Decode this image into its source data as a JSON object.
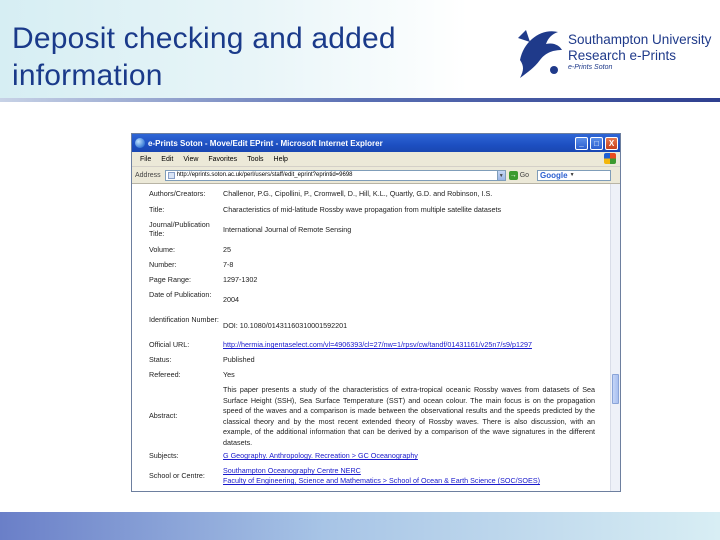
{
  "slide": {
    "title_line1": "Deposit checking and added",
    "title_line2": "information",
    "logo": {
      "line1": "Southampton University",
      "line2": "Research e-Prints",
      "line3": "e-Prints Soton"
    }
  },
  "browser": {
    "window_title": "e-Prints Soton - Move/Edit EPrint - Microsoft Internet Explorer",
    "buttons": {
      "minimize": "_",
      "maximize": "□",
      "close": "X"
    },
    "menu": [
      "File",
      "Edit",
      "View",
      "Favorites",
      "Tools",
      "Help"
    ],
    "address_label": "Address",
    "address_url": "http://eprints.soton.ac.uk/perl/users/staff/edit_eprint?eprintid=9698",
    "go_label": "Go",
    "search_engine": "Google"
  },
  "record": [
    {
      "label": "Authors/Creators:",
      "value": "Challenor, P.G., Cipollini, P., Cromwell, D., Hill, K.L., Quartly, G.D. and Robinson, I.S."
    },
    {
      "label": "Title:",
      "value": "Characteristics of mid-latitude Rossby wave propagation from multiple satellite datasets"
    },
    {
      "label": "Journal/Publication Title:",
      "value": "International Journal of Remote Sensing"
    },
    {
      "label": "Volume:",
      "value": "25"
    },
    {
      "label": "Number:",
      "value": "7-8"
    },
    {
      "label": "Page Range:",
      "value": "1297-1302"
    },
    {
      "label": "Date of Publication:",
      "value": "2004"
    },
    {
      "label": "Identification Number:",
      "value": "DOI: 10.1080/01431160310001592201"
    },
    {
      "label": "Official URL:",
      "value": "http://hermia.ingentaselect.com/vl=4906393/cl=27/nw=1/rpsv/cw/tandf/01431161/v25n7/s9/p1297"
    },
    {
      "label": "Status:",
      "value": "Published"
    },
    {
      "label": "Refereed:",
      "value": "Yes"
    },
    {
      "label": "Abstract:",
      "value": "This paper presents a study of the characteristics of extra-tropical oceanic Rossby waves from datasets of Sea Surface Height (SSH), Sea Surface Temperature (SST) and ocean colour. The main focus is on the propagation speed of the waves and a comparison is made between the observational results and the speeds predicted by the classical theory and by the most recent extended theory of Rossby waves. There is also discussion, with an example, of the additional information that can be derived by a comparison of the wave signatures in the different datasets."
    },
    {
      "label": "Subjects:",
      "value": "G Geography. Anthropology. Recreation > GC Oceanography"
    },
    {
      "label": "School or Centre:",
      "value_lines": [
        "Southampton Oceanography Centre NERC",
        "Faculty of Engineering, Science and Mathematics > School of Ocean & Earth Science (SOC/SOES)"
      ]
    }
  ]
}
